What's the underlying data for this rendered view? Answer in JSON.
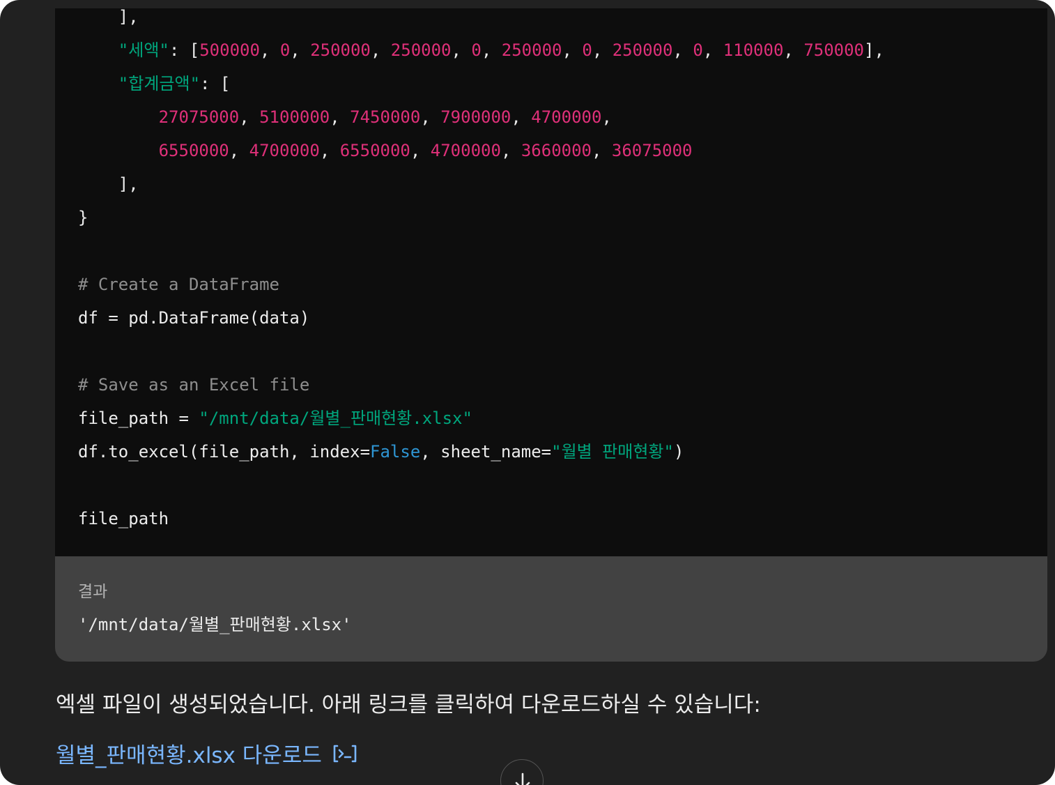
{
  "code_block": {
    "lines": [
      [
        {
          "t": "    ],",
          "c": ""
        }
      ],
      [
        {
          "t": "    ",
          "c": ""
        },
        {
          "t": "\"세액\"",
          "c": "str"
        },
        {
          "t": ": [",
          "c": ""
        },
        {
          "t": "500000",
          "c": "num"
        },
        {
          "t": ", ",
          "c": ""
        },
        {
          "t": "0",
          "c": "num"
        },
        {
          "t": ", ",
          "c": ""
        },
        {
          "t": "250000",
          "c": "num"
        },
        {
          "t": ", ",
          "c": ""
        },
        {
          "t": "250000",
          "c": "num"
        },
        {
          "t": ", ",
          "c": ""
        },
        {
          "t": "0",
          "c": "num"
        },
        {
          "t": ", ",
          "c": ""
        },
        {
          "t": "250000",
          "c": "num"
        },
        {
          "t": ", ",
          "c": ""
        },
        {
          "t": "0",
          "c": "num"
        },
        {
          "t": ", ",
          "c": ""
        },
        {
          "t": "250000",
          "c": "num"
        },
        {
          "t": ", ",
          "c": ""
        },
        {
          "t": "0",
          "c": "num"
        },
        {
          "t": ", ",
          "c": ""
        },
        {
          "t": "110000",
          "c": "num"
        },
        {
          "t": ", ",
          "c": ""
        },
        {
          "t": "750000",
          "c": "num"
        },
        {
          "t": "],",
          "c": ""
        }
      ],
      [
        {
          "t": "    ",
          "c": ""
        },
        {
          "t": "\"합계금액\"",
          "c": "str"
        },
        {
          "t": ": [",
          "c": ""
        }
      ],
      [
        {
          "t": "        ",
          "c": ""
        },
        {
          "t": "27075000",
          "c": "num"
        },
        {
          "t": ", ",
          "c": ""
        },
        {
          "t": "5100000",
          "c": "num"
        },
        {
          "t": ", ",
          "c": ""
        },
        {
          "t": "7450000",
          "c": "num"
        },
        {
          "t": ", ",
          "c": ""
        },
        {
          "t": "7900000",
          "c": "num"
        },
        {
          "t": ", ",
          "c": ""
        },
        {
          "t": "4700000",
          "c": "num"
        },
        {
          "t": ",",
          "c": ""
        }
      ],
      [
        {
          "t": "        ",
          "c": ""
        },
        {
          "t": "6550000",
          "c": "num"
        },
        {
          "t": ", ",
          "c": ""
        },
        {
          "t": "4700000",
          "c": "num"
        },
        {
          "t": ", ",
          "c": ""
        },
        {
          "t": "6550000",
          "c": "num"
        },
        {
          "t": ", ",
          "c": ""
        },
        {
          "t": "4700000",
          "c": "num"
        },
        {
          "t": ", ",
          "c": ""
        },
        {
          "t": "3660000",
          "c": "num"
        },
        {
          "t": ", ",
          "c": ""
        },
        {
          "t": "36075000",
          "c": "num"
        }
      ],
      [
        {
          "t": "    ],",
          "c": ""
        }
      ],
      [
        {
          "t": "}",
          "c": ""
        }
      ],
      [
        {
          "t": "",
          "c": ""
        }
      ],
      [
        {
          "t": "# Create a DataFrame",
          "c": "cmt"
        }
      ],
      [
        {
          "t": "df = pd.DataFrame(data)",
          "c": ""
        }
      ],
      [
        {
          "t": "",
          "c": ""
        }
      ],
      [
        {
          "t": "# Save as an Excel file",
          "c": "cmt"
        }
      ],
      [
        {
          "t": "file_path = ",
          "c": ""
        },
        {
          "t": "\"/mnt/data/월별_판매현황.xlsx\"",
          "c": "str"
        }
      ],
      [
        {
          "t": "df.to_excel(file_path, index=",
          "c": ""
        },
        {
          "t": "False",
          "c": "kw"
        },
        {
          "t": ", sheet_name=",
          "c": ""
        },
        {
          "t": "\"월별 판매현황\"",
          "c": "str"
        },
        {
          "t": ")",
          "c": ""
        }
      ],
      [
        {
          "t": "",
          "c": ""
        }
      ],
      [
        {
          "t": "file_path",
          "c": ""
        }
      ]
    ]
  },
  "result": {
    "label": "결과",
    "value": "'/mnt/data/월별_판매현황.xlsx'"
  },
  "message": "엑셀 파일이 생성되었습니다. 아래 링크를 클릭하여 다운로드하실 수 있습니다:",
  "download_link": {
    "label": "월별_판매현황.xlsx 다운로드",
    "icon": "code-interpreter-icon"
  },
  "scroll_button": {
    "icon": "arrow-down-icon"
  },
  "colors": {
    "background": "#212121",
    "code_bg": "#0d0d0d",
    "result_bg": "#424242",
    "string": "#00a67d",
    "number": "#df3079",
    "comment": "#8e8e8e",
    "keyword": "#2e95d3",
    "link": "#7ab7ff"
  }
}
